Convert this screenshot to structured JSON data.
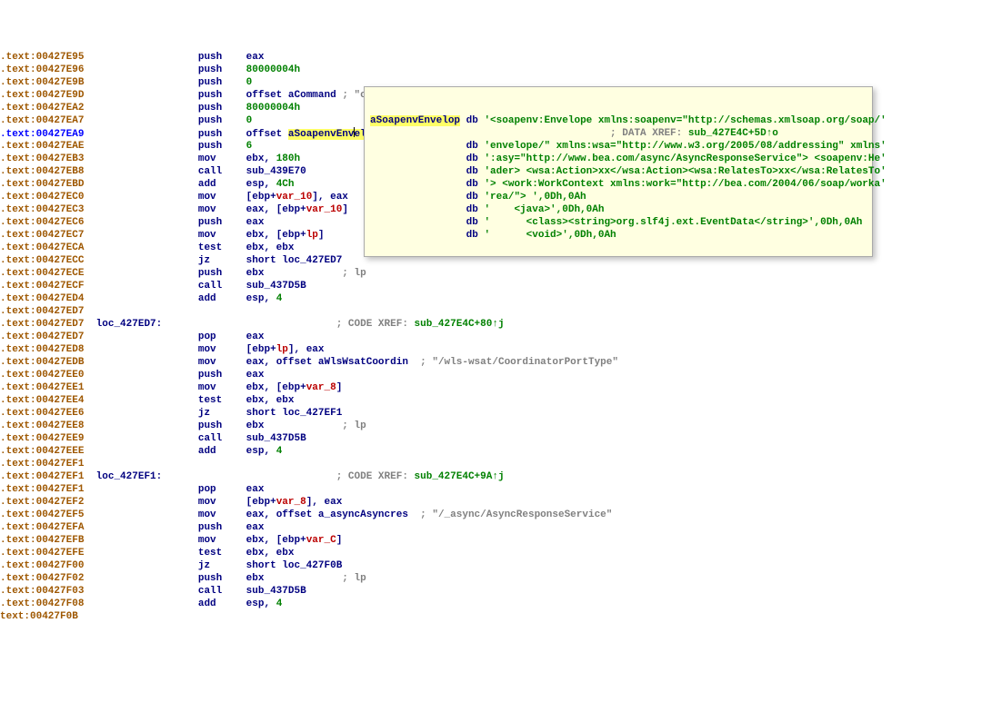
{
  "lines": [
    {
      "addr": ".text:00427E95",
      "nav": false,
      "mnem": "push",
      "arg": "eax",
      "kind": "reg"
    },
    {
      "addr": ".text:00427E96",
      "nav": false,
      "mnem": "push",
      "arg": "80000004h",
      "kind": "num"
    },
    {
      "addr": ".text:00427E9B",
      "nav": false,
      "mnem": "push",
      "arg": "0",
      "kind": "num"
    },
    {
      "addr": ".text:00427E9D",
      "nav": false,
      "mnem": "push",
      "arg_prefix": "offset ",
      "arg": "aCommand",
      "kind": "name",
      "comment": "; \"command\""
    },
    {
      "addr": ".text:00427EA2",
      "nav": false,
      "mnem": "push",
      "arg": "80000004h",
      "kind": "num"
    },
    {
      "addr": ".text:00427EA7",
      "nav": false,
      "mnem": "push",
      "arg": "0",
      "kind": "num"
    },
    {
      "addr": ".text:00427EA9",
      "nav": true,
      "mnem": "push",
      "arg_prefix": "offset ",
      "arg": "aSoapenvEnvelop",
      "kind": "name",
      "hl": true,
      "cursor": 11,
      "comment": "; '<soapenv:Envelope xmlns:soapenv=\\\"http:'..."
    },
    {
      "addr": ".text:00427EAE",
      "nav": false,
      "mnem": "push",
      "arg": "6",
      "kind": "num"
    },
    {
      "addr": ".text:00427EB3",
      "nav": false,
      "mnem": "mov",
      "arg": "ebx",
      "kind": "reg",
      "second": "180h",
      "secondkind": "num"
    },
    {
      "addr": ".text:00427EB8",
      "nav": false,
      "mnem": "call",
      "arg": "sub_439E70",
      "kind": "name"
    },
    {
      "addr": ".text:00427EBD",
      "nav": false,
      "mnem": "add",
      "arg": "esp",
      "kind": "reg",
      "second": "4Ch",
      "secondkind": "num"
    },
    {
      "addr": ".text:00427EC0",
      "nav": false,
      "mnem": "mov",
      "memarg": "[ebp+",
      "var": "var_10",
      "memtail": "], eax"
    },
    {
      "addr": ".text:00427EC3",
      "nav": false,
      "mnem": "mov",
      "arg": "eax, ",
      "memarg": "[ebp+",
      "var": "var_10",
      "memtail": "]"
    },
    {
      "addr": ".text:00427EC6",
      "nav": false,
      "mnem": "push",
      "arg": "eax",
      "kind": "reg"
    },
    {
      "addr": ".text:00427EC7",
      "nav": false,
      "mnem": "mov",
      "arg": "ebx, ",
      "memarg": "[ebp+",
      "var": "lp",
      "memtail": "]"
    },
    {
      "addr": ".text:00427ECA",
      "nav": false,
      "mnem": "test",
      "arg": "ebx, ebx",
      "kind": "reg"
    },
    {
      "addr": ".text:00427ECC",
      "nav": false,
      "mnem": "jz",
      "arg_prefix": "short ",
      "arg": "loc_427ED7",
      "kind": "name"
    },
    {
      "addr": ".text:00427ECE",
      "nav": false,
      "mnem": "push",
      "arg": "ebx",
      "kind": "reg",
      "tailcomment": "             ; lp"
    },
    {
      "addr": ".text:00427ECF",
      "nav": false,
      "mnem": "call",
      "arg": "sub_437D5B",
      "kind": "name"
    },
    {
      "addr": ".text:00427ED4",
      "nav": false,
      "mnem": "add",
      "arg": "esp",
      "kind": "reg",
      "second": "4",
      "secondkind": "num"
    },
    {
      "addr": ".text:00427ED7",
      "nav": false,
      "blank": true
    },
    {
      "addr": ".text:00427ED7",
      "nav": false,
      "label": "loc_427ED7:",
      "xrefcode": "; CODE XREF: ",
      "xrefsub": "sub_427E4C+80↑j"
    },
    {
      "addr": ".text:00427ED7",
      "nav": false,
      "mnem": "pop",
      "arg": "eax",
      "kind": "reg"
    },
    {
      "addr": ".text:00427ED8",
      "nav": false,
      "mnem": "mov",
      "memarg": "[ebp+",
      "var": "lp",
      "memtail": "], eax"
    },
    {
      "addr": ".text:00427EDB",
      "nav": false,
      "mnem": "mov",
      "arg": "eax, ",
      "arg_prefix2": "offset ",
      "arg2": "aWlsWsatCoordin",
      "kind2": "name",
      "comment": " ; \"/wls-wsat/CoordinatorPortType\""
    },
    {
      "addr": ".text:00427EE0",
      "nav": false,
      "mnem": "push",
      "arg": "eax",
      "kind": "reg"
    },
    {
      "addr": ".text:00427EE1",
      "nav": false,
      "mnem": "mov",
      "arg": "ebx, ",
      "memarg": "[ebp+",
      "var": "var_8",
      "memtail": "]"
    },
    {
      "addr": ".text:00427EE4",
      "nav": false,
      "mnem": "test",
      "arg": "ebx, ebx",
      "kind": "reg"
    },
    {
      "addr": ".text:00427EE6",
      "nav": false,
      "mnem": "jz",
      "arg_prefix": "short ",
      "arg": "loc_427EF1",
      "kind": "name"
    },
    {
      "addr": ".text:00427EE8",
      "nav": false,
      "mnem": "push",
      "arg": "ebx",
      "kind": "reg",
      "tailcomment": "             ; lp"
    },
    {
      "addr": ".text:00427EE9",
      "nav": false,
      "mnem": "call",
      "arg": "sub_437D5B",
      "kind": "name"
    },
    {
      "addr": ".text:00427EEE",
      "nav": false,
      "mnem": "add",
      "arg": "esp",
      "kind": "reg",
      "second": "4",
      "secondkind": "num"
    },
    {
      "addr": ".text:00427EF1",
      "nav": false,
      "blank": true
    },
    {
      "addr": ".text:00427EF1",
      "nav": false,
      "label": "loc_427EF1:",
      "xrefcode": "; CODE XREF: ",
      "xrefsub": "sub_427E4C+9A↑j"
    },
    {
      "addr": ".text:00427EF1",
      "nav": false,
      "mnem": "pop",
      "arg": "eax",
      "kind": "reg"
    },
    {
      "addr": ".text:00427EF2",
      "nav": false,
      "mnem": "mov",
      "memarg": "[ebp+",
      "var": "var_8",
      "memtail": "], eax"
    },
    {
      "addr": ".text:00427EF5",
      "nav": false,
      "mnem": "mov",
      "arg": "eax, ",
      "arg_prefix2": "offset ",
      "arg2": "a_asyncAsyncres",
      "kind2": "name",
      "comment": " ; \"/_async/AsyncResponseService\""
    },
    {
      "addr": ".text:00427EFA",
      "nav": false,
      "mnem": "push",
      "arg": "eax",
      "kind": "reg"
    },
    {
      "addr": ".text:00427EFB",
      "nav": false,
      "mnem": "mov",
      "arg": "ebx, ",
      "memarg": "[ebp+",
      "var": "var_C",
      "memtail": "]"
    },
    {
      "addr": ".text:00427EFE",
      "nav": false,
      "mnem": "test",
      "arg": "ebx, ebx",
      "kind": "reg"
    },
    {
      "addr": ".text:00427F00",
      "nav": false,
      "mnem": "jz",
      "arg_prefix": "short ",
      "arg": "loc_427F0B",
      "kind": "name"
    },
    {
      "addr": ".text:00427F02",
      "nav": false,
      "mnem": "push",
      "arg": "ebx",
      "kind": "reg",
      "tailcomment": "             ; lp"
    },
    {
      "addr": ".text:00427F03",
      "nav": false,
      "mnem": "call",
      "arg": "sub_437D5B",
      "kind": "name"
    },
    {
      "addr": ".text:00427F08",
      "nav": false,
      "mnem": "add",
      "arg": "esp",
      "kind": "reg",
      "second": "4",
      "secondkind": "num"
    },
    {
      "addr": "text:00427F0B",
      "nav": false,
      "trunc": true
    }
  ],
  "tooltip": {
    "sym": "aSoapenvEnvelop",
    "dir": "db",
    "xreflabel": "; DATA XREF: ",
    "xrefsub": "sub_427E4C+5D↑o",
    "strings": [
      "'<soapenv:Envelope xmlns:soapenv=\"http://schemas.xmlsoap.org/soap/'",
      "'envelope/\" xmlns:wsa=\"http://www.w3.org/2005/08/addressing\" xmlns'",
      "':asy=\"http://www.bea.com/async/AsyncResponseService\"> <soapenv:He'",
      "'ader> <wsa:Action>xx</wsa:Action><wsa:RelatesTo>xx</wsa:RelatesTo'",
      "'> <work:WorkContext xmlns:work=\"http://bea.com/2004/06/soap/worka'",
      "'rea/\"> ',0Dh,0Ah",
      "'    <java>',0Dh,0Ah",
      "'      <class><string>org.slf4j.ext.EventData</string>',0Dh,0Ah",
      "'      <void>',0Dh,0Ah"
    ]
  }
}
